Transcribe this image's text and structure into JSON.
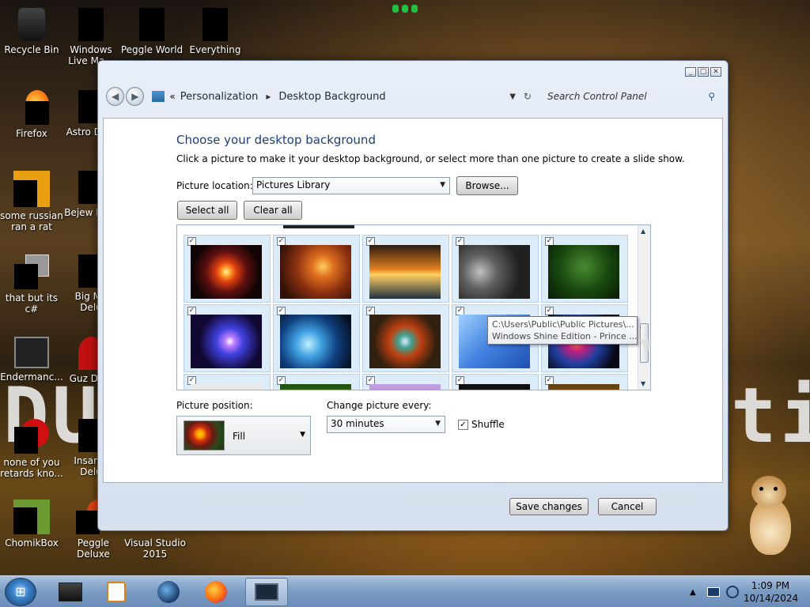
{
  "desktop": {
    "icons": [
      {
        "label": "Recycle Bin"
      },
      {
        "label": "Windows Live Ma..."
      },
      {
        "label": "Peggle World"
      },
      {
        "label": "Everything"
      },
      {
        "label": "Firefox"
      },
      {
        "label": "Astro Delu"
      },
      {
        "label": "some russian ran a rat"
      },
      {
        "label": "Bejew Delu"
      },
      {
        "label": "that but its c#"
      },
      {
        "label": "Big Mo Delu"
      },
      {
        "label": "Endermanc..."
      },
      {
        "label": "Guz Delu"
      },
      {
        "label": "none of you retards kno..."
      },
      {
        "label": "Insaniq Delu"
      },
      {
        "label": "ChomikBox"
      },
      {
        "label": "Peggle Deluxe"
      },
      {
        "label": "Visual Studio 2015"
      }
    ],
    "wallpaper_text_left": "DU",
    "wallpaper_text_right": "ti"
  },
  "window": {
    "breadcrumb": [
      "Personalization",
      "Desktop Background"
    ],
    "breadcrumb_chevron": "«",
    "breadcrumb_sep": "▸",
    "search_placeholder": "Search Control Panel",
    "title": "Choose your desktop background",
    "description": "Click a picture to make it your desktop background, or select more than one picture to create a slide show.",
    "picture_location_label": "Picture location:",
    "picture_location_value": "Pictures Library",
    "browse_label": "Browse...",
    "select_all_label": "Select all",
    "clear_all_label": "Clear all",
    "tooltip_line1": "C:\\Users\\Public\\Public Pictures\\...",
    "tooltip_line2": "Windows Shine Edition - Prince ...",
    "picture_position_label": "Picture position:",
    "picture_position_value": "Fill",
    "change_picture_label": "Change picture every:",
    "change_picture_value": "30 minutes",
    "shuffle_label": "Shuffle",
    "save_label": "Save changes",
    "cancel_label": "Cancel"
  },
  "taskbar": {
    "time": "1:09 PM",
    "date": "10/14/2024"
  }
}
